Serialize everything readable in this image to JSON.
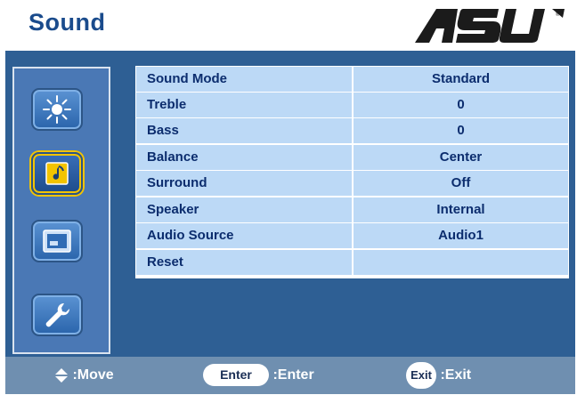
{
  "header": {
    "title": "Sound",
    "brand": "ASUS"
  },
  "sidebar": {
    "items": [
      {
        "icon": "brightness-icon"
      },
      {
        "icon": "music-note-icon",
        "active": true
      },
      {
        "icon": "display-window-icon"
      },
      {
        "icon": "wrench-icon"
      }
    ]
  },
  "menu": {
    "rows": [
      {
        "label": "Sound Mode",
        "value": "Standard"
      },
      {
        "label": "Treble",
        "value": "0"
      },
      {
        "label": "Bass",
        "value": "0"
      },
      {
        "label": "Balance",
        "value": "Center"
      },
      {
        "label": "Surround",
        "value": "Off"
      },
      {
        "label": "Speaker",
        "value": "Internal"
      },
      {
        "label": "Audio Source",
        "value": "Audio1"
      },
      {
        "label": "Reset",
        "value": ""
      }
    ]
  },
  "footer": {
    "move_label": ":Move",
    "enter_key": "Enter",
    "enter_label": ":Enter",
    "exit_key": "Exit",
    "exit_label": ":Exit"
  },
  "colors": {
    "panel": "#2e5f94",
    "cell": "#bcd9f6",
    "title": "#1a4b8c",
    "footer": "#6f8fb0",
    "active_outline": "#f3c400"
  }
}
